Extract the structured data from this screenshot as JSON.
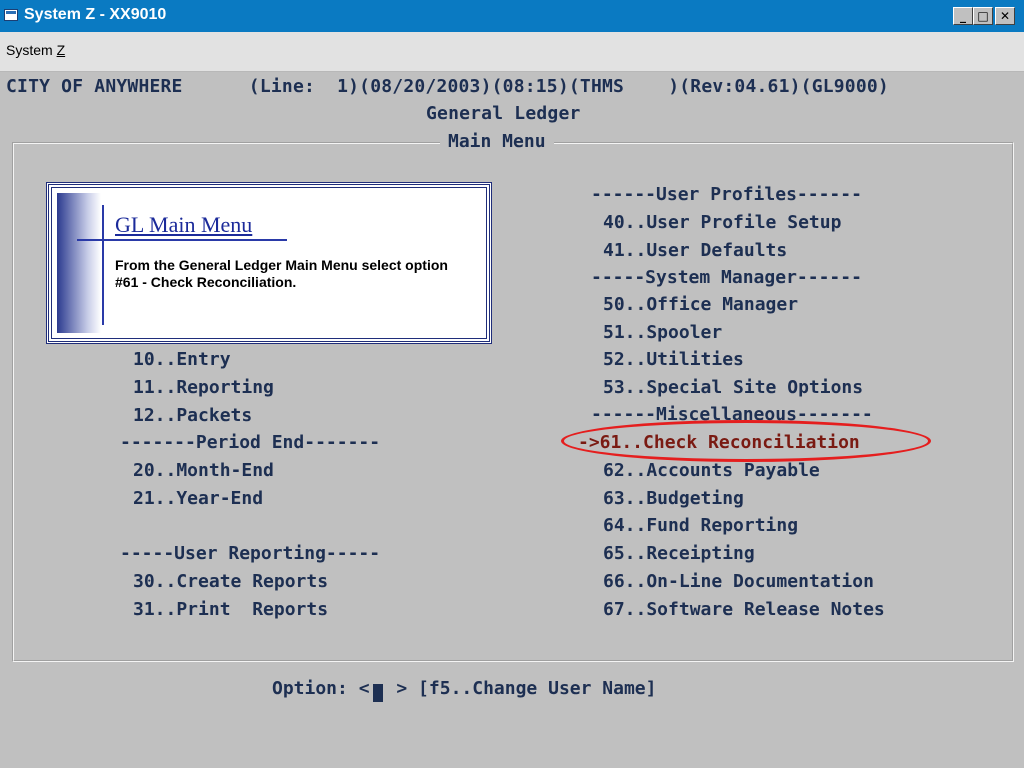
{
  "window": {
    "title": "System Z - XX9010",
    "controls": {
      "minimize": "_",
      "maximize": "□",
      "close": "✕"
    }
  },
  "menubar": {
    "item_prefix": "System ",
    "item_accel": "Z"
  },
  "header": {
    "line1": "CITY OF ANYWHERE      (Line:  1)(08/20/2003)(08:15)(THMS    )(Rev:04.61)(GL9000)",
    "line2": "General Ledger"
  },
  "panel": {
    "title": "Main Menu"
  },
  "callout": {
    "title": "GL Main Menu",
    "body": "From the General Ledger Main Menu select option #61 - Check Reconciliation."
  },
  "left_menu": [
    {
      "text": "10..Entry"
    },
    {
      "text": "11..Reporting"
    },
    {
      "text": "12..Packets"
    },
    {
      "text": "-------Period End-------"
    },
    {
      "text": "20..Month-End"
    },
    {
      "text": "21..Year-End"
    },
    {
      "text": "-----User Reporting-----"
    },
    {
      "text": "30..Create Reports"
    },
    {
      "text": "31..Print  Reports"
    }
  ],
  "right_menu": [
    {
      "text": "------User Profiles------"
    },
    {
      "text": "40..User Profile Setup"
    },
    {
      "text": "41..User Defaults"
    },
    {
      "text": "-----System Manager------"
    },
    {
      "text": "50..Office Manager"
    },
    {
      "text": "51..Spooler"
    },
    {
      "text": "52..Utilities"
    },
    {
      "text": "53..Special Site Options"
    },
    {
      "text": "------Miscellaneous-------"
    },
    {
      "text": "->61..Check Reconciliation"
    },
    {
      "text": "62..Accounts Payable"
    },
    {
      "text": "63..Budgeting"
    },
    {
      "text": "64..Fund Reporting"
    },
    {
      "text": "65..Receipting"
    },
    {
      "text": "66..On-Line Documentation"
    },
    {
      "text": "67..Software Release Notes"
    }
  ],
  "prompt": {
    "label": "Option: <",
    "after": " > [f5..Change User Name]",
    "value": ""
  },
  "colors": {
    "titlebar": "#0a7ac2",
    "terminal_text": "#1d2f52",
    "selected_text": "#7a1a12",
    "highlight": "#e51e1e",
    "callout_accent": "#1b2a9a"
  }
}
